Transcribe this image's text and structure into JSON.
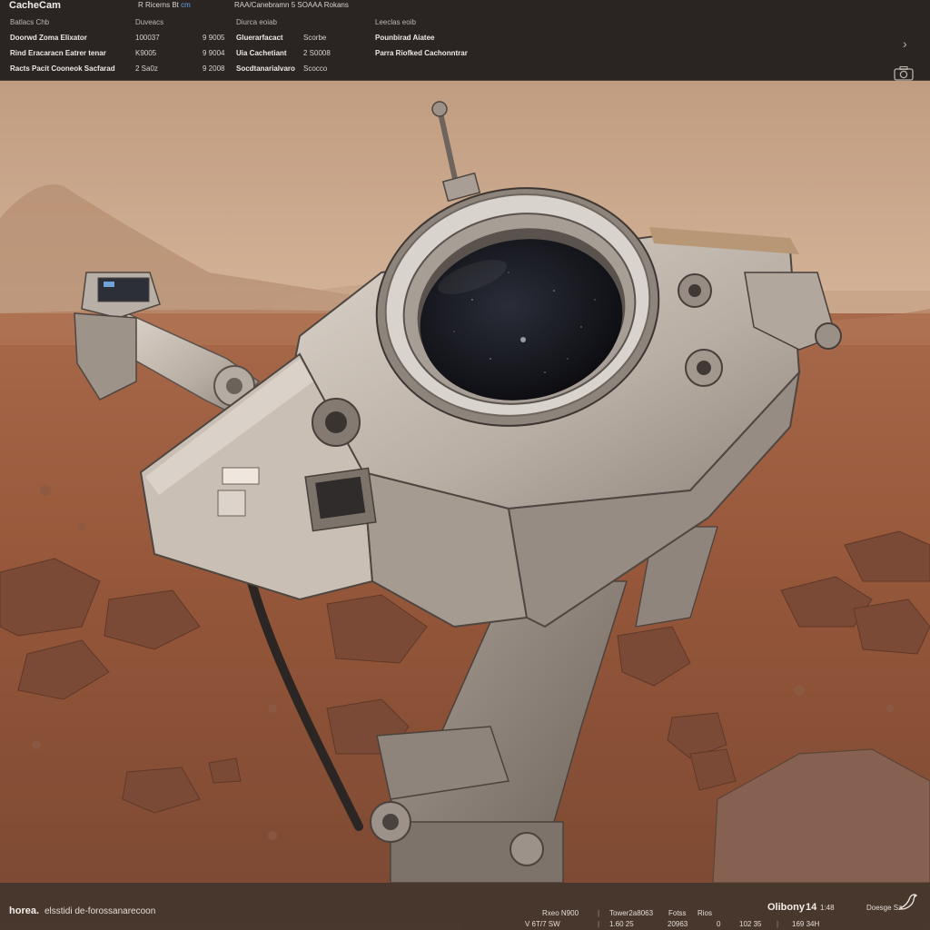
{
  "header": {
    "app_title": "CacheCam",
    "tab_primary": "R Ricerns Bt",
    "tab_accent": "cm",
    "tab_secondary": "RAA/Canebramn  5  SOAAA Rokans",
    "columns": [
      {
        "label": "Batlacs Chb"
      },
      {
        "label": "Duveacs"
      },
      {
        "label": "Diurca eoiab"
      },
      {
        "label": "Leeclas eoib"
      }
    ],
    "rows": [
      {
        "name": "Doorwd Zoma Elixator",
        "value_a": "100037",
        "value_b": "9 9005",
        "label_c": "Gluerarfacact",
        "value_d": "Scorbe",
        "label_e": "Pounbirad Aiatee"
      },
      {
        "name": "Rind Eracaracn Eatrer tenar",
        "value_a": "K9005",
        "value_b": "9 9004",
        "label_c": "Uia Cachetiant",
        "value_d": "2 S0008",
        "label_e": "Parra Riofked Cachonntrar"
      },
      {
        "name": "Racts Pacit Cooneok Sacfarad",
        "value_a": "2 Sa0z",
        "value_b": "9 2008",
        "label_c": "Socdtanarialvaro",
        "value_d": "Scocco",
        "label_e": ""
      }
    ],
    "chevron_icon": "chevron-right",
    "camera_icon": "camera"
  },
  "footer": {
    "brand": "horea.",
    "tagline": "elsstidi de-forossanarecoon",
    "stats_labels": [
      "Rxeo N900",
      "|",
      "Tower2a8063",
      "Fotss",
      "Rios"
    ],
    "stats_values": [
      "V  6T/7 SW",
      "|",
      "1.60 25",
      "20963",
      "0",
      "102 35",
      "|",
      "169 34H"
    ],
    "highlight_label": "Olibony",
    "highlight_value": "14",
    "highlight_unit": "1:48",
    "right_label": "Doesge Sz",
    "logo_icon": "bird-logo"
  },
  "colors": {
    "panel_bg": "#2a2523",
    "accent": "#63a4e8",
    "sky": "#c7a488",
    "ground": "#9a5a3c",
    "rover_body": "#cfc6bd",
    "lens": "#15161c"
  }
}
